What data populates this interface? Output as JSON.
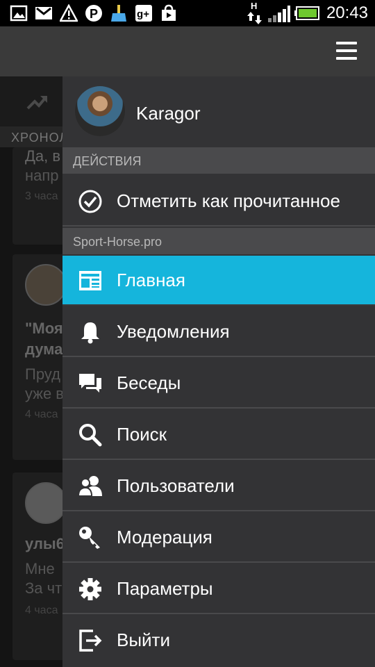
{
  "status_bar": {
    "time": "20:43",
    "network_label": "H"
  },
  "background": {
    "section_label": "ХРОНОЛ",
    "cards": [
      {
        "line1": "Да, в",
        "line2": "напр",
        "time": "3 часа"
      },
      {
        "title1": "\"Моя",
        "title2": "дума",
        "line1": "Пруд",
        "line2": "уже в",
        "time": "4 часа"
      },
      {
        "title1": "улы6",
        "line1": "Мне",
        "line2": "За чт",
        "time": "4 часа"
      }
    ]
  },
  "drawer": {
    "user_name": "Karagor",
    "actions_header": "ДЕЙСТВИЯ",
    "mark_read_label": "Отметить как прочитанное",
    "site_header": "Sport-Horse.pro",
    "items": [
      {
        "label": "Главная",
        "icon": "news-icon",
        "active": true
      },
      {
        "label": "Уведомления",
        "icon": "bell-icon"
      },
      {
        "label": "Беседы",
        "icon": "chat-icon"
      },
      {
        "label": "Поиск",
        "icon": "search-icon"
      },
      {
        "label": "Пользователи",
        "icon": "users-icon"
      },
      {
        "label": "Модерация",
        "icon": "key-icon"
      },
      {
        "label": "Параметры",
        "icon": "gear-icon"
      },
      {
        "label": "Выйти",
        "icon": "logout-icon"
      }
    ]
  },
  "colors": {
    "accent": "#15b5dc",
    "drawer_bg": "#333335",
    "header_bg": "#4a4a4c"
  }
}
